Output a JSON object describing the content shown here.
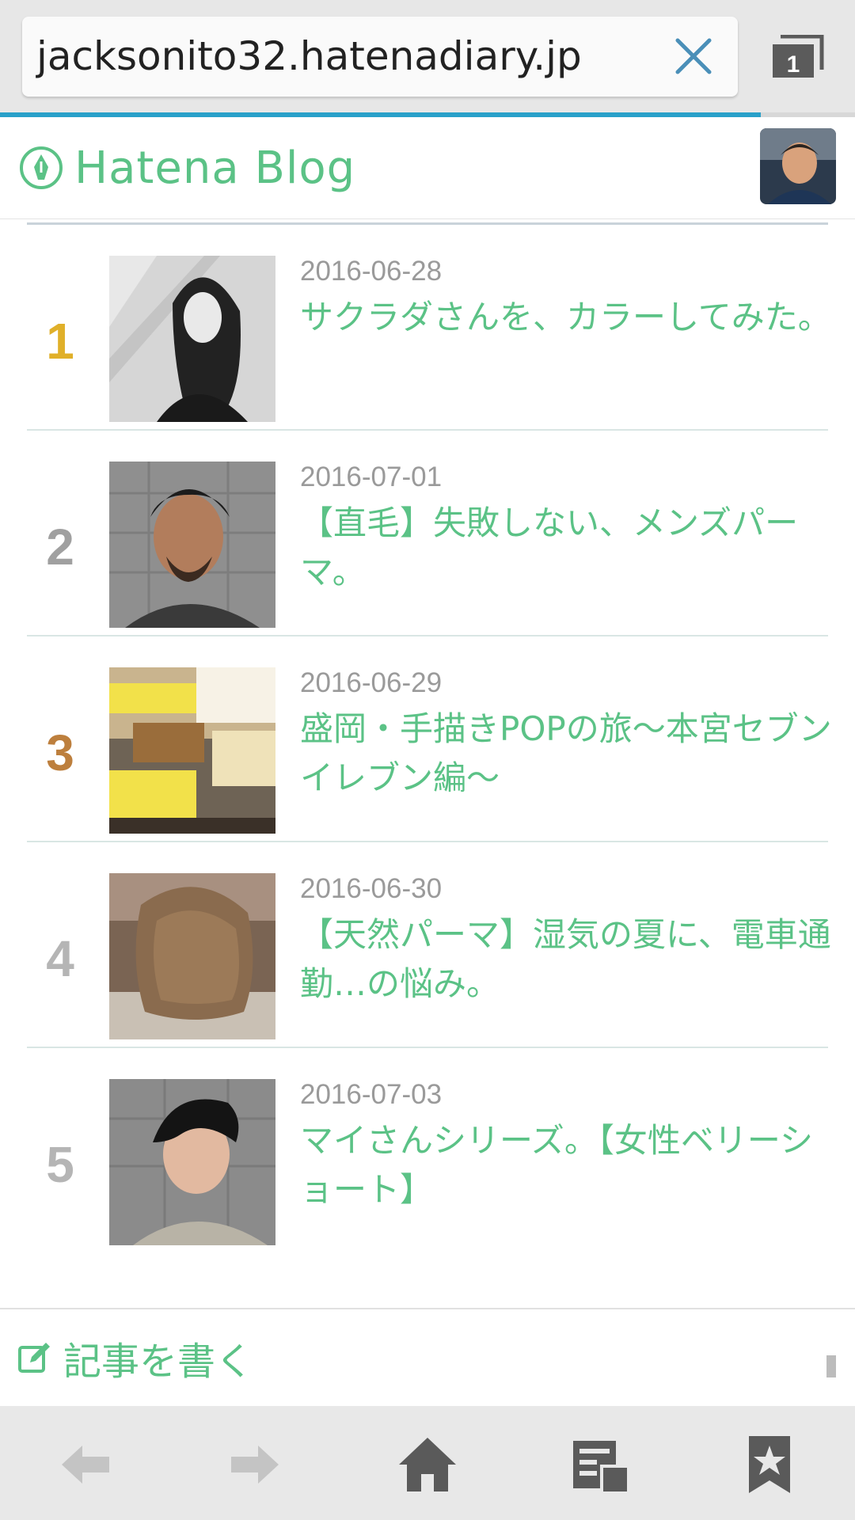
{
  "browser": {
    "url": "jacksonito32.hatenadiary.jp",
    "tab_count": "1",
    "progress": 0.89
  },
  "header": {
    "brand": "Hatena Blog"
  },
  "ranking": [
    {
      "rank": "1",
      "rank_color": "#e0b02a",
      "date": "2016-06-28",
      "title": "サクラダさんを、カラーしてみた。"
    },
    {
      "rank": "2",
      "rank_color": "#a0a0a0",
      "date": "2016-07-01",
      "title": "【直毛】失敗しない、メンズパーマ。"
    },
    {
      "rank": "3",
      "rank_color": "#bd7f3d",
      "date": "2016-06-29",
      "title": "盛岡・手描きPOPの旅〜本宮セブンイレブン編〜"
    },
    {
      "rank": "4",
      "rank_color": "#b5b5b5",
      "date": "2016-06-30",
      "title": "【天然パーマ】湿気の夏に、電車通勤…の悩み。"
    },
    {
      "rank": "5",
      "rank_color": "#b5b5b5",
      "date": "2016-07-03",
      "title": "マイさんシリーズ。【女性ベリーショート】"
    }
  ],
  "write": {
    "label": "記事を書く"
  },
  "toolbar": {
    "icons": [
      "back-arrow-icon",
      "forward-arrow-icon",
      "home-icon",
      "reader-icon",
      "bookmark-star-icon"
    ]
  }
}
